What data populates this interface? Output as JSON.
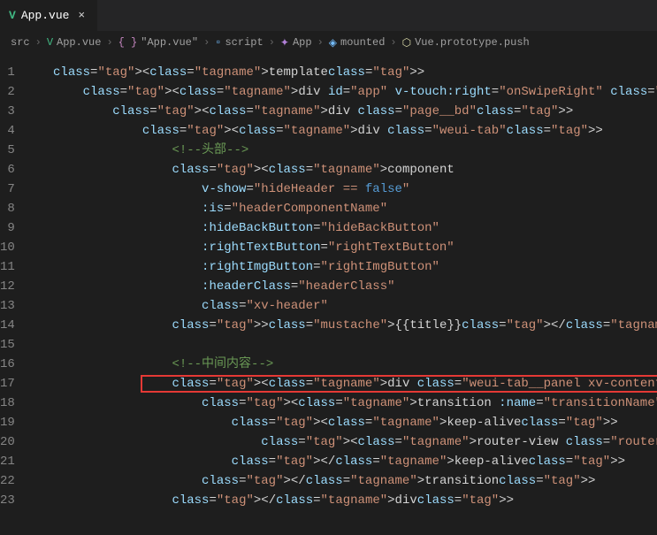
{
  "tab": {
    "icon": "V",
    "title": "App.vue",
    "close": "×"
  },
  "breadcrumb": {
    "items": [
      {
        "icon": "",
        "text": "src"
      },
      {
        "icon": "V",
        "iconClass": "ic-vue",
        "text": "App.vue"
      },
      {
        "icon": "{ }",
        "iconClass": "ic-brace",
        "text": "\"App.vue\""
      },
      {
        "icon": "▫",
        "iconClass": "ic-cube",
        "text": "script"
      },
      {
        "icon": "✦",
        "iconClass": "ic-method",
        "text": "App"
      },
      {
        "icon": "◈",
        "iconClass": "ic-cube",
        "text": "mounted"
      },
      {
        "icon": "⬡",
        "iconClass": "ic-fn",
        "text": "Vue.prototype.push"
      }
    ],
    "sep": "›"
  },
  "lines": {
    "l1": "   <template>",
    "l2": "       <div id=\"app\" v-touch:right=\"onSwipeRight\" class=\"page js_show\">",
    "l3": "           <div class=\"page__bd\">",
    "l4": "               <div class=\"weui-tab\">",
    "l5": "                   <!--头部-->",
    "l6": "                   <component",
    "l7": "                       v-show=\"hideHeader == false\"",
    "l8": "                       :is=\"headerComponentName\"",
    "l9": "                       :hideBackButton=\"hideBackButton\"",
    "l10": "                       :rightTextButton=\"rightTextButton\"",
    "l11": "                       :rightImgButton=\"rightImgButton\"",
    "l12": "                       :headerClass=\"headerClass\"",
    "l13": "                       class=\"xv-header\"",
    "l14": "                   >{{title}}</component>",
    "l15": "",
    "l16": "                   <!--中间内容-->",
    "l17": "                   <div class=\"weui-tab__panel xv-content\" ref=\"wrapper\">",
    "l18": "                       <transition :name=\"transitionName\">",
    "l19": "                           <keep-alive>",
    "l20": "                               <router-view class=\"router-view\"></router-view>",
    "l21": "                           </keep-alive>",
    "l22": "                       </transition>",
    "l23": "                   </div>"
  },
  "lineNumbers": [
    "1",
    "2",
    "3",
    "4",
    "5",
    "6",
    "7",
    "8",
    "9",
    "10",
    "11",
    "12",
    "13",
    "14",
    "15",
    "16",
    "17",
    "18",
    "19",
    "20",
    "21",
    "22",
    "23"
  ]
}
